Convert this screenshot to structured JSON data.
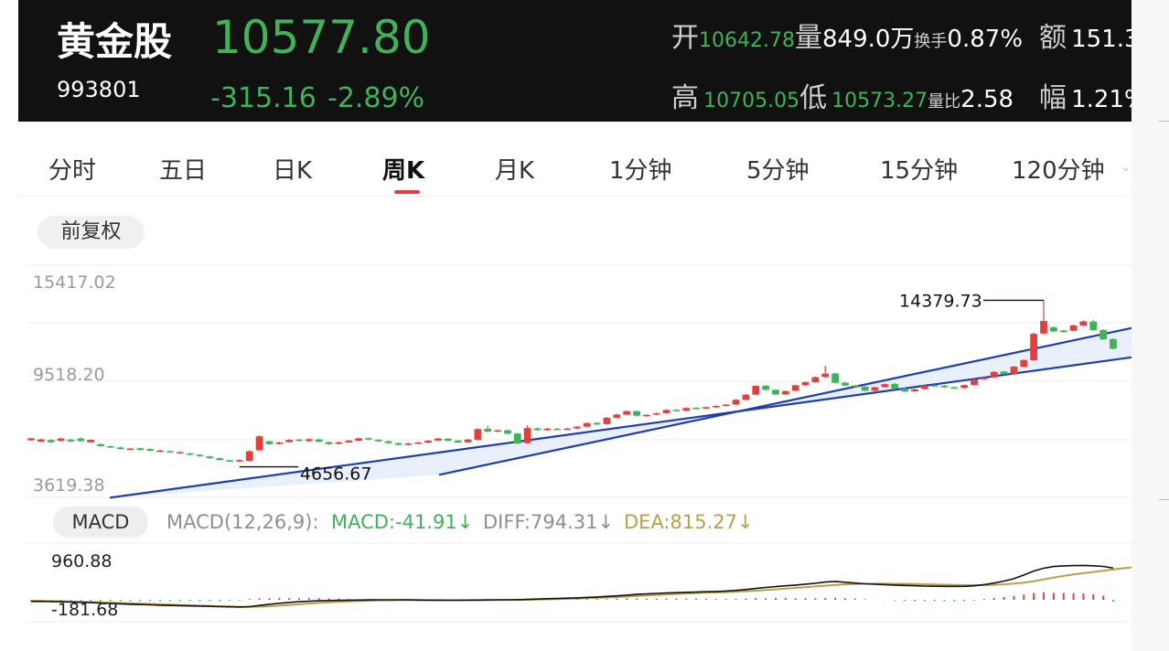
{
  "header": {
    "name": "黄金股",
    "code": "993801",
    "price": "10577.80",
    "change": "-315.16",
    "change_pct": "-2.89%",
    "quote": {
      "open_label": "开",
      "open": "10642.78",
      "vol_label": "量",
      "vol": "849.0万",
      "turnover_label": "换手",
      "turnover": "0.87%",
      "amount_label": "额",
      "amount": "151.3",
      "high_label": "高",
      "high": "10705.05",
      "low_label": "低",
      "low": "10573.27",
      "ratio_label": "量比",
      "ratio": "2.58",
      "range_label": "幅",
      "range": "1.21%"
    }
  },
  "tabs": [
    "分时",
    "五日",
    "日K",
    "周K",
    "月K",
    "1分钟",
    "5分钟",
    "15分钟",
    "120分钟"
  ],
  "active_tab": "周K",
  "adjust_button": "前复权",
  "macd": {
    "button": "MACD",
    "params": "MACD(12,26,9):",
    "macd": "MACD:-41.91",
    "diff": "DIFF:794.31",
    "dea": "DEA:815.27",
    "arrow": "↓"
  },
  "colors": {
    "up": "#e0413e",
    "down": "#3fb25a",
    "channel": "#1f3fa8",
    "dea": "#b8a048",
    "diff": "#111111"
  },
  "chart_data": [
    {
      "type": "candlestick",
      "ylabels": [
        "15417.02",
        "9518.20",
        "3619.38"
      ],
      "ylim": [
        3619.38,
        15417.02
      ],
      "annotations": [
        {
          "text": "14379.73",
          "value": 14379.73,
          "label": "max"
        },
        {
          "text": "4656.67",
          "value": 4656.67,
          "label": "min"
        }
      ],
      "channel": {
        "lower_start": 2855,
        "lower_end": 11050,
        "upper_start": 4190,
        "upper_end": 12760
      },
      "candles": [
        [
          6210,
          6320,
          6160,
          6350
        ],
        [
          6130,
          6260,
          6100,
          6300
        ],
        [
          6220,
          6090,
          6050,
          6280
        ],
        [
          6170,
          6310,
          6140,
          6360
        ],
        [
          6250,
          6140,
          6100,
          6300
        ],
        [
          6310,
          6160,
          6120,
          6390
        ],
        [
          6090,
          6230,
          6050,
          6270
        ],
        [
          5980,
          5860,
          5820,
          6030
        ],
        [
          5860,
          5800,
          5760,
          5900
        ],
        [
          5790,
          5700,
          5660,
          5840
        ],
        [
          5660,
          5720,
          5620,
          5770
        ],
        [
          5740,
          5640,
          5600,
          5780
        ],
        [
          5700,
          5600,
          5560,
          5740
        ],
        [
          5540,
          5610,
          5500,
          5660
        ],
        [
          5580,
          5520,
          5480,
          5620
        ],
        [
          5470,
          5510,
          5430,
          5560
        ],
        [
          5440,
          5360,
          5320,
          5480
        ],
        [
          5360,
          5280,
          5240,
          5400
        ],
        [
          5260,
          5160,
          5120,
          5300
        ],
        [
          5160,
          5060,
          5020,
          5200
        ],
        [
          5040,
          4990,
          4960,
          5080
        ],
        [
          4980,
          5050,
          4940,
          5100
        ],
        [
          5000,
          5560,
          4960,
          5640
        ],
        [
          5620,
          6440,
          5580,
          6500
        ],
        [
          6150,
          5980,
          5940,
          6190
        ],
        [
          5990,
          6080,
          5950,
          6130
        ],
        [
          6100,
          6230,
          6060,
          6280
        ],
        [
          6250,
          6170,
          6130,
          6290
        ],
        [
          6160,
          6270,
          6120,
          6320
        ],
        [
          6260,
          6120,
          6080,
          6300
        ],
        [
          6100,
          5980,
          5940,
          6140
        ],
        [
          6000,
          6090,
          5960,
          6130
        ],
        [
          6080,
          6190,
          6040,
          6230
        ],
        [
          6180,
          6320,
          6140,
          6370
        ],
        [
          6330,
          6260,
          6210,
          6370
        ],
        [
          6240,
          6150,
          6110,
          6280
        ],
        [
          6150,
          6040,
          6000,
          6190
        ],
        [
          6040,
          5940,
          5900,
          6080
        ],
        [
          5960,
          6020,
          5920,
          6070
        ],
        [
          6030,
          6080,
          5990,
          6120
        ],
        [
          6070,
          6180,
          6030,
          6230
        ],
        [
          6190,
          6310,
          6150,
          6360
        ],
        [
          6300,
          6180,
          6140,
          6340
        ],
        [
          6190,
          6080,
          6040,
          6230
        ],
        [
          6090,
          6250,
          6050,
          6290
        ],
        [
          6240,
          6860,
          6200,
          6910
        ],
        [
          6880,
          6710,
          6670,
          7080
        ],
        [
          6730,
          6790,
          6690,
          6830
        ],
        [
          6790,
          6590,
          6540,
          6840
        ],
        [
          6600,
          6020,
          5980,
          6640
        ],
        [
          6040,
          6920,
          6000,
          7090
        ],
        [
          6900,
          6800,
          6760,
          6940
        ],
        [
          6800,
          6890,
          6760,
          6940
        ],
        [
          6880,
          6840,
          6800,
          6930
        ],
        [
          6840,
          6890,
          6800,
          6940
        ],
        [
          6900,
          7000,
          6860,
          7040
        ],
        [
          7000,
          7210,
          6960,
          7260
        ],
        [
          7220,
          7130,
          7090,
          7270
        ],
        [
          7150,
          7520,
          7110,
          7570
        ],
        [
          7520,
          7710,
          7480,
          7760
        ],
        [
          7700,
          7910,
          7660,
          7950
        ],
        [
          7910,
          7640,
          7600,
          7950
        ],
        [
          7650,
          7690,
          7610,
          7730
        ],
        [
          7700,
          7780,
          7660,
          7820
        ],
        [
          7790,
          7980,
          7750,
          8020
        ],
        [
          7980,
          7920,
          7880,
          8020
        ],
        [
          7930,
          8090,
          7890,
          8130
        ],
        [
          8100,
          8060,
          8020,
          8140
        ],
        [
          8060,
          8140,
          8020,
          8180
        ],
        [
          8140,
          8210,
          8100,
          8250
        ],
        [
          8210,
          8290,
          8170,
          8330
        ],
        [
          8300,
          8570,
          8260,
          8620
        ],
        [
          8570,
          8870,
          8530,
          8920
        ],
        [
          8870,
          9380,
          8830,
          9420
        ],
        [
          9390,
          9150,
          9110,
          9440
        ],
        [
          9150,
          8880,
          8840,
          9190
        ],
        [
          8890,
          9080,
          8850,
          9120
        ],
        [
          9100,
          9420,
          9060,
          9460
        ],
        [
          9420,
          9600,
          9380,
          9640
        ],
        [
          9600,
          9890,
          9560,
          9940
        ],
        [
          9900,
          10100,
          9860,
          10560
        ],
        [
          10110,
          9560,
          9520,
          10160
        ],
        [
          9570,
          9400,
          9360,
          9620
        ],
        [
          9410,
          9330,
          9290,
          9450
        ],
        [
          9340,
          9100,
          9060,
          9380
        ],
        [
          9110,
          9300,
          9070,
          9340
        ],
        [
          9320,
          9480,
          9280,
          9520
        ],
        [
          9500,
          9220,
          9180,
          9560
        ],
        [
          9230,
          9050,
          9010,
          9270
        ],
        [
          9060,
          9180,
          9020,
          9220
        ],
        [
          9200,
          9400,
          9160,
          9440
        ],
        [
          9420,
          9380,
          9340,
          9460
        ],
        [
          9400,
          9300,
          9260,
          9440
        ],
        [
          9310,
          9250,
          9210,
          9340
        ],
        [
          9260,
          9430,
          9220,
          9470
        ],
        [
          9440,
          9760,
          9400,
          9800
        ],
        [
          9770,
          9870,
          9730,
          9910
        ],
        [
          9880,
          10200,
          9840,
          10240
        ],
        [
          10220,
          10060,
          10020,
          10260
        ],
        [
          10070,
          10500,
          10030,
          10550
        ],
        [
          10500,
          10890,
          10460,
          10940
        ],
        [
          10880,
          12420,
          10840,
          12500
        ],
        [
          12440,
          13170,
          12400,
          14379.73
        ],
        [
          12800,
          12560,
          12520,
          12860
        ],
        [
          12620,
          12520,
          12480,
          12660
        ],
        [
          12600,
          12910,
          12560,
          12960
        ],
        [
          12900,
          13150,
          12860,
          13200
        ],
        [
          13140,
          12640,
          12600,
          13250
        ],
        [
          12650,
          12100,
          12060,
          12700
        ],
        [
          12120,
          11550,
          11510,
          12160
        ]
      ]
    },
    {
      "type": "bar",
      "title": "MACD",
      "ylabels": [
        "960.88",
        "-181.68"
      ],
      "ylim": [
        -181.68,
        960.88
      ],
      "series": [
        {
          "name": "DIFF",
          "values": [
            -40,
            -38,
            -42,
            -48,
            -55,
            -62,
            -70,
            -80,
            -90,
            -100,
            -110,
            -118,
            -125,
            -133,
            -140,
            -146,
            -152,
            -158,
            -164,
            -170,
            -175,
            -179,
            -170,
            -140,
            -110,
            -85,
            -65,
            -48,
            -35,
            -25,
            -18,
            -12,
            -8,
            -5,
            -2,
            0,
            1,
            0,
            -2,
            -5,
            -8,
            -9,
            -10,
            -10,
            -9,
            -5,
            -3,
            0,
            2,
            3,
            10,
            20,
            28,
            34,
            42,
            50,
            60,
            72,
            85,
            100,
            118,
            135,
            150,
            162,
            172,
            180,
            188,
            195,
            202,
            210,
            220,
            236,
            258,
            285,
            310,
            330,
            350,
            370,
            392,
            415,
            445,
            460,
            440,
            420,
            402,
            390,
            380,
            370,
            360,
            352,
            345,
            340,
            338,
            336,
            338,
            350,
            380,
            420,
            470,
            530,
            620,
            720,
            790,
            832,
            850,
            855,
            860,
            852,
            835,
            794.31
          ]
        },
        {
          "name": "DEA",
          "values": [
            -20,
            -25,
            -30,
            -36,
            -42,
            -48,
            -55,
            -62,
            -70,
            -78,
            -86,
            -94,
            -102,
            -110,
            -118,
            -126,
            -134,
            -142,
            -150,
            -158,
            -166,
            -172,
            -175,
            -170,
            -160,
            -145,
            -128,
            -110,
            -92,
            -76,
            -62,
            -50,
            -40,
            -32,
            -25,
            -18,
            -12,
            -8,
            -6,
            -6,
            -7,
            -8,
            -8,
            -8,
            -8,
            -7,
            -6,
            -4,
            -2,
            0,
            3,
            8,
            14,
            20,
            26,
            32,
            40,
            49,
            59,
            70,
            82,
            96,
            110,
            123,
            136,
            148,
            158,
            167,
            176,
            185,
            194,
            204,
            216,
            230,
            246,
            262,
            280,
            298,
            316,
            335,
            355,
            374,
            388,
            397,
            402,
            404,
            404,
            402,
            398,
            394,
            389,
            384,
            379,
            374,
            370,
            366,
            368,
            376,
            388,
            406,
            430,
            466,
            510,
            556,
            598,
            634,
            666,
            696,
            726,
            758,
            790,
            815.27
          ]
        },
        {
          "name": "MACD",
          "values": [
            -30,
            -30,
            -30,
            -30,
            -30,
            -30,
            -30,
            -30,
            -30,
            -30,
            -30,
            -30,
            -30,
            -30,
            -30,
            -30,
            -30,
            -30,
            -30,
            -30,
            -20,
            -20,
            20,
            35,
            40,
            45,
            45,
            40,
            40,
            40,
            35,
            30,
            20,
            15,
            15,
            15,
            15,
            10,
            10,
            10,
            10,
            10,
            10,
            10,
            5,
            5,
            5,
            5,
            5,
            5,
            10,
            15,
            15,
            15,
            15,
            15,
            20,
            20,
            20,
            30,
            35,
            30,
            30,
            30,
            30,
            30,
            30,
            30,
            25,
            20,
            20,
            25,
            35,
            40,
            40,
            45,
            45,
            40,
            40,
            40,
            45,
            45,
            40,
            30,
            15,
            5,
            -5,
            -15,
            -25,
            -30,
            -30,
            -30,
            -30,
            -30,
            -30,
            -20,
            20,
            45,
            70,
            95,
            130,
            170,
            180,
            170,
            170,
            165,
            160,
            140,
            100,
            -41.91
          ]
        }
      ]
    }
  ]
}
